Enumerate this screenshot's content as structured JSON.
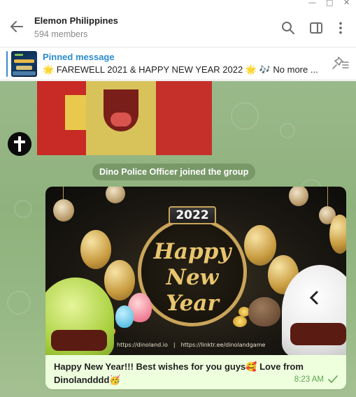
{
  "window": {
    "minimize_icon": "minimize-icon",
    "maximize_icon": "maximize-icon",
    "close_icon": "close-icon"
  },
  "header": {
    "title": "Elemon Philippines",
    "subtitle": "594 members",
    "icons": [
      "back-arrow-icon",
      "search-icon",
      "sidebar-toggle-icon",
      "more-vertical-icon"
    ]
  },
  "pinned": {
    "label": "Pinned message",
    "text": "🌟 FAREWELL 2021 & HAPPY NEW YEAR 2022 🌟 🎶 No more ..."
  },
  "chat": {
    "service_message": "Dino Police Officer joined the group",
    "photo_message": {
      "image": {
        "year": "2022",
        "headline_line1": "Happy",
        "headline_line2": "New Year",
        "link1": "https://dinoland.io",
        "separator": "|",
        "link2": "https://linktr.ee/dinolandgame"
      },
      "caption": "Happy New Year!!! Best wishes for you guys🥰 Love from Dinolandddd🥳",
      "time": "8:23 AM",
      "status": "read"
    }
  },
  "colors": {
    "accent": "#2b8ccf",
    "chat_bg": "#97b985",
    "bubble_bg": "#eeffde",
    "time_color": "#5fa44e"
  }
}
